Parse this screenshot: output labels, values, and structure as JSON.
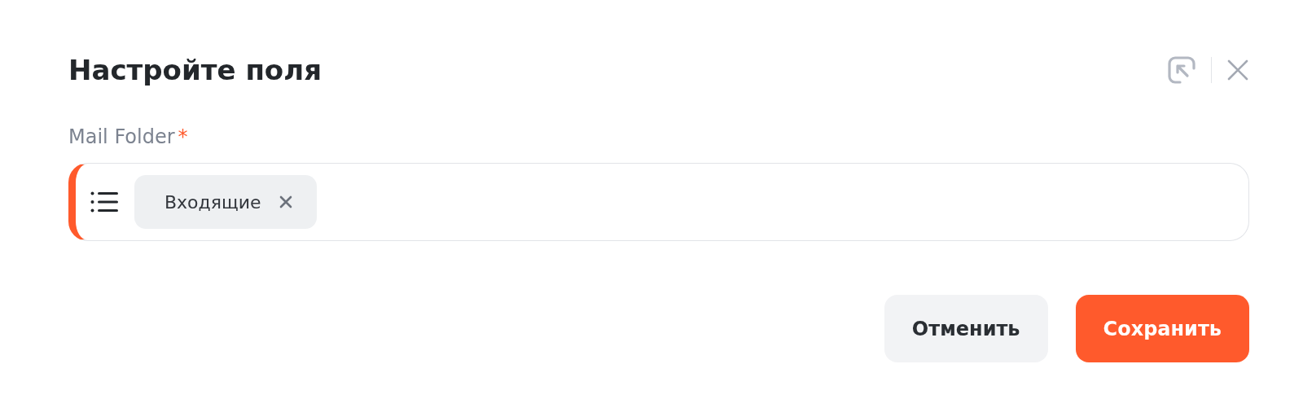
{
  "dialog": {
    "title": "Настройте поля"
  },
  "field": {
    "label": "Mail Folder",
    "required_mark": "*",
    "invalid": true,
    "chips": [
      {
        "label": "Входящие"
      }
    ]
  },
  "buttons": [
    {
      "label": "Отменить",
      "kind": "secondary"
    },
    {
      "label": "Сохранить",
      "kind": "primary"
    }
  ]
}
